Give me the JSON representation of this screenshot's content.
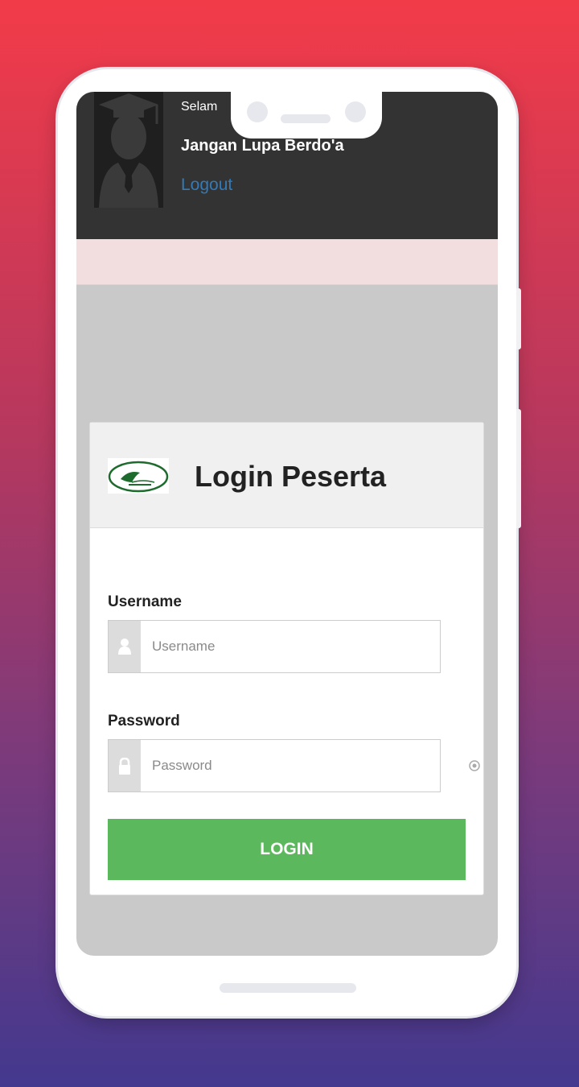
{
  "header": {
    "greeting": "Selam",
    "reminder": "Jangan Lupa Berdo'a",
    "logout_label": "Logout"
  },
  "login": {
    "title": "Login Peserta",
    "username_label": "Username",
    "username_placeholder": "Username",
    "password_label": "Password",
    "password_placeholder": "Password",
    "submit_label": "LOGIN"
  },
  "icons": {
    "avatar": "graduate-avatar-icon",
    "logo": "school-logo",
    "username": "user-icon",
    "password": "lock-icon",
    "toggle": "eye-icon"
  },
  "colors": {
    "header_bg": "#333333",
    "alert_bg": "#f2dede",
    "link": "#337ab7",
    "button": "#5cb85c"
  }
}
